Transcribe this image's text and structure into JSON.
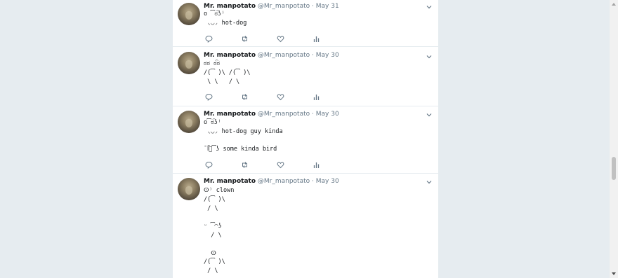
{
  "tweets": [
    {
      "name": "Mr. manpotato",
      "handle": "@Mr_manpotato",
      "separator": "·",
      "date": "May 31",
      "lines": [
        "o ͡ಠ͡ʖ⁾",
        " ◟◡◞ hot-dog"
      ]
    },
    {
      "name": "Mr. manpotato",
      "handle": "@Mr_manpotato",
      "separator": "·",
      "date": "May 30",
      "lines": [
        "ಠಠ ಠ͡ಠ",
        "/(͡ )\\ /(͡ )\\",
        " \\ \\   / \\"
      ]
    },
    {
      "name": "Mr. manpotato",
      "handle": "@Mr_manpotato",
      "separator": "·",
      "date": "May 30",
      "lines": [
        "o͡ಠ͡ʖ⁾",
        " ◟◡◞ hot-dog guy kinda",
        "",
        "¯ᥬᩚ͡ʖ some kinda bird"
      ]
    },
    {
      "name": "Mr. manpotato",
      "handle": "@Mr_manpotato",
      "separator": "·",
      "date": "May 30",
      "lines": [
        "ⵙ⁾ clown",
        "/(͡ )\\",
        " / \\",
        "",
        "ᵕ ͡◠ʖ",
        "  / \\",
        "",
        "  ⵙ",
        "/(͡ )\\",
        " / \\"
      ]
    }
  ],
  "icons": {
    "reply": "reply-icon",
    "retweet": "retweet-icon",
    "like": "like-icon",
    "analytics": "analytics-icon",
    "caret": "chevron-down-icon"
  },
  "colors": {
    "page_background": "#e6ecf0",
    "card": "#ffffff",
    "secondary_text": "#657786",
    "icon": "#657786"
  }
}
